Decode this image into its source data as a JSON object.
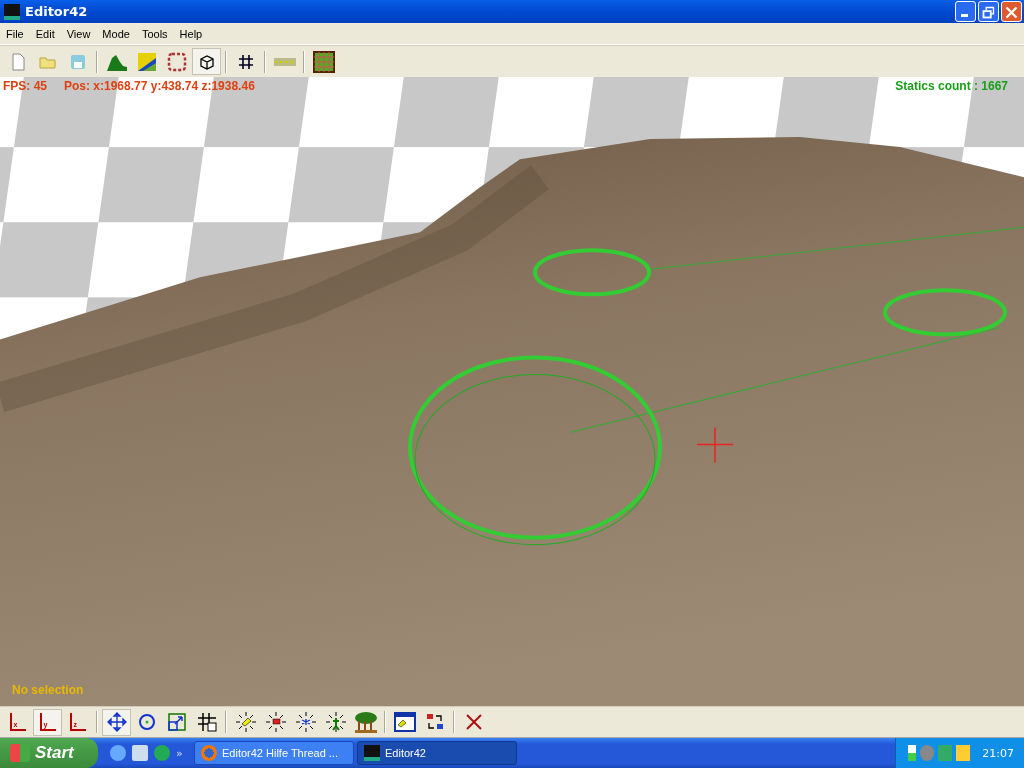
{
  "window": {
    "title": "Editor42"
  },
  "menu": [
    "File",
    "Edit",
    "View",
    "Mode",
    "Tools",
    "Help"
  ],
  "toolbar": [
    {
      "kind": "new",
      "selected": false
    },
    {
      "kind": "open",
      "selected": false
    },
    {
      "kind": "save",
      "selected": false
    },
    {
      "kind": "separator"
    },
    {
      "kind": "terrain",
      "selected": false
    },
    {
      "kind": "texture",
      "selected": false
    },
    {
      "kind": "area",
      "selected": false
    },
    {
      "kind": "object",
      "selected": true
    },
    {
      "kind": "separator"
    },
    {
      "kind": "grid",
      "selected": false
    },
    {
      "kind": "separator"
    },
    {
      "kind": "road",
      "selected": false
    },
    {
      "kind": "separator"
    },
    {
      "kind": "tilegrid",
      "selected": false
    }
  ],
  "viewport": {
    "fps": "FPS: 45",
    "position": "Pos: x:1968.77  y:438.74  z:1938.46",
    "statics": "Statics count : 1667",
    "selection": "No selection"
  },
  "bottom_toolbar": [
    {
      "kind": "axis",
      "label": "x",
      "selected": false
    },
    {
      "kind": "axis",
      "label": "y",
      "selected": true
    },
    {
      "kind": "axis",
      "label": "z",
      "selected": false
    },
    {
      "kind": "separator"
    },
    {
      "kind": "move",
      "selected": true
    },
    {
      "kind": "rotate",
      "selected": false
    },
    {
      "kind": "scale",
      "selected": false
    },
    {
      "kind": "snap",
      "selected": false
    },
    {
      "kind": "separator"
    },
    {
      "kind": "light",
      "selected": false
    },
    {
      "kind": "light-flag",
      "selected": false
    },
    {
      "kind": "light-star",
      "selected": false
    },
    {
      "kind": "light-person",
      "selected": false
    },
    {
      "kind": "trees",
      "selected": false
    },
    {
      "kind": "separator"
    },
    {
      "kind": "window",
      "selected": false
    },
    {
      "kind": "swap",
      "selected": false
    },
    {
      "kind": "separator"
    },
    {
      "kind": "delete",
      "selected": false
    }
  ],
  "taskbar": {
    "start": "Start",
    "overflow": "»",
    "tasks": [
      {
        "kind": "browser",
        "label": "Editor42 Hilfe Thread ...",
        "selected": false
      },
      {
        "kind": "editor",
        "label": "Editor42",
        "selected": true
      }
    ],
    "clock": "21:07"
  }
}
